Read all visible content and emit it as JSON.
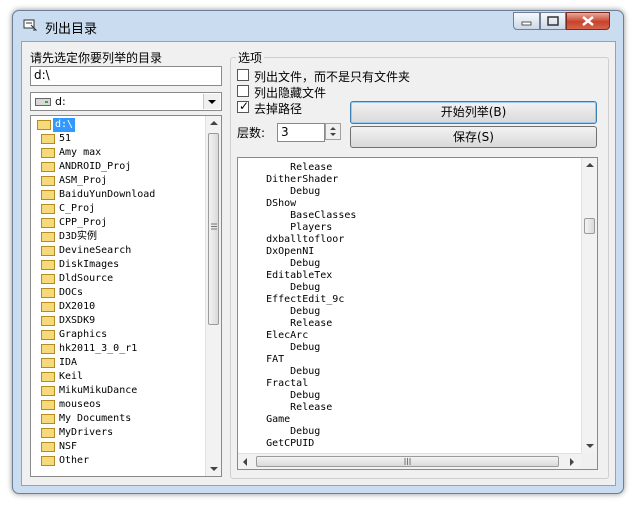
{
  "window": {
    "title": "列出目录"
  },
  "left": {
    "prompt_label": "请先选定你要列举的目录",
    "path_value": "d:\\",
    "drive_value": "d:",
    "directories": [
      "d:\\",
      "51",
      "Amy max",
      "ANDROID_Proj",
      "ASM_Proj",
      "BaiduYunDownload",
      "C_Proj",
      "CPP_Proj",
      "D3D实例",
      "DevineSearch",
      "DiskImages",
      "DldSource",
      "DOCs",
      "DX2010",
      "DXSDK9",
      "Graphics",
      "hk2011_3_0_r1",
      "IDA",
      "Keil",
      "MikuMikuDance",
      "mouseos",
      "My Documents",
      "MyDrivers",
      "NSF",
      "Other"
    ]
  },
  "options": {
    "group_label": "选项",
    "list_files_label": "列出文件，而不是只有文件夹",
    "list_files_checked": false,
    "list_hidden_label": "列出隐藏文件",
    "list_hidden_checked": false,
    "strip_path_label": "去掉路径",
    "strip_path_checked": true,
    "levels_label": "层数:",
    "levels_value": "3",
    "start_button": "开始列举(B)",
    "save_button": "保存(S)"
  },
  "output": {
    "lines": [
      "        Release",
      "    DitherShader",
      "        Debug",
      "    DShow",
      "        BaseClasses",
      "        Players",
      "    dxballtofloor",
      "    DxOpenNI",
      "        Debug",
      "    EditableTex",
      "        Debug",
      "    EffectEdit_9c",
      "        Debug",
      "        Release",
      "    ElecArc",
      "        Debug",
      "    FAT",
      "        Debug",
      "    Fractal",
      "        Debug",
      "        Release",
      "    Game",
      "        Debug",
      "    GetCPUID"
    ]
  }
}
